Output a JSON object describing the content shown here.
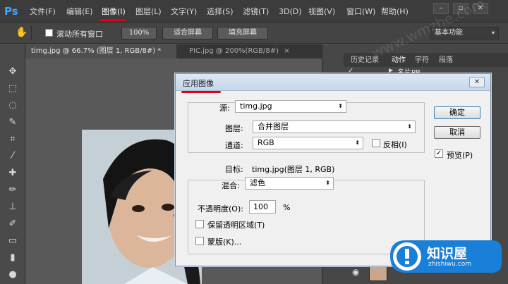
{
  "app": {
    "logo": "Ps",
    "menu": [
      "文件(F)",
      "编辑(E)",
      "图像(I)",
      "图层(L)",
      "文字(Y)",
      "选择(S)",
      "滤镜(T)",
      "3D(D)",
      "视图(V)",
      "窗口(W)",
      "帮助(H)"
    ],
    "highlighted_menu": "图像(I)",
    "window_controls": [
      "–",
      "▫",
      "✕"
    ]
  },
  "options": {
    "scroll_all_label": "滚动所有窗口",
    "zoom_value": "100%",
    "fit_screen_label": "适合屏幕",
    "fill_screen_label": "填充屏幕",
    "workspace_label": "基本功能"
  },
  "tabs": {
    "doc1": "timg.jpg @ 66.7% (图层 1, RGB/8#) *",
    "doc1_close": "×",
    "doc2": "PIC.jpg @ 200%(RGB/8#)",
    "doc2_close": "×"
  },
  "panels": {
    "tabs": [
      "历史记录",
      "动作",
      "字符",
      "段落"
    ],
    "action_item": "名片PB"
  },
  "dialog": {
    "title": "应用图像",
    "close_label": "✕",
    "source_label": "源:",
    "source_value": "timg.jpg",
    "layer_label": "图层:",
    "layer_value": "合并图层",
    "channel_label": "通道:",
    "channel_value": "RGB",
    "invert_label": "反相(I)",
    "target_label": "目标:",
    "target_value": "timg.jpg(图层 1, RGB)",
    "blend_label": "混合:",
    "blend_value": "滤色",
    "opacity_label": "不透明度(O):",
    "opacity_value": "100",
    "opacity_unit": "%",
    "preserve_label": "保留透明区域(T)",
    "mask_label": "蒙版(K)...",
    "ok_label": "确定",
    "cancel_label": "取消",
    "preview_label": "预览(P)",
    "preview_checked": true
  },
  "watermark": {
    "site_text": "www.wmzhe.com",
    "brand_cn": "知识屋",
    "brand_en": "zhishiwu.com"
  },
  "colors": {
    "accent_blue": "#3fa6ff",
    "highlight_red": "#e2001a",
    "badge_blue": "#1a7fd8"
  }
}
